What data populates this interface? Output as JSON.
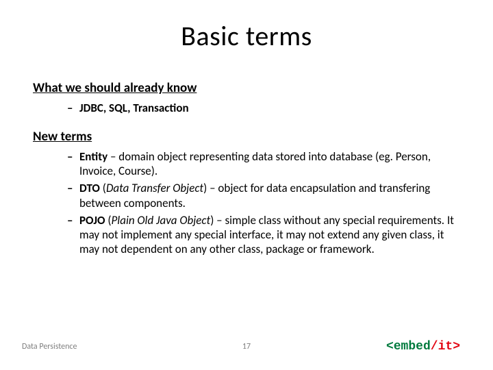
{
  "title": "Basic terms",
  "section1": {
    "heading": "What we should already know",
    "bullet": "JDBC, SQL, Transaction"
  },
  "section2": {
    "heading": "New terms",
    "bullets": {
      "entity_prefix": "Entity",
      "entity_rest": " – domain object representing data stored into database (eg. Person, Invoice, Course).",
      "dto_prefix": "DTO",
      "dto_paren_open": " (",
      "dto_italic": "Data Transfer Object",
      "dto_paren_close": ")",
      "dto_rest": " – object for data encapsulation and transfering between components.",
      "pojo_prefix": "POJO",
      "pojo_paren_open": " (",
      "pojo_italic": "Plain Old Java Object",
      "pojo_paren_close": ")",
      "pojo_rest": " – simple class without any special requirements. It may not implement any special interface, it may not extend any given class, it  may not dependent on any other class, package or framework."
    }
  },
  "footer": {
    "left": "Data Persistence",
    "page": "17",
    "logo": {
      "lt": "<",
      "word1": "embed",
      "slash": "/",
      "word2": "it",
      "gt": ">"
    }
  }
}
